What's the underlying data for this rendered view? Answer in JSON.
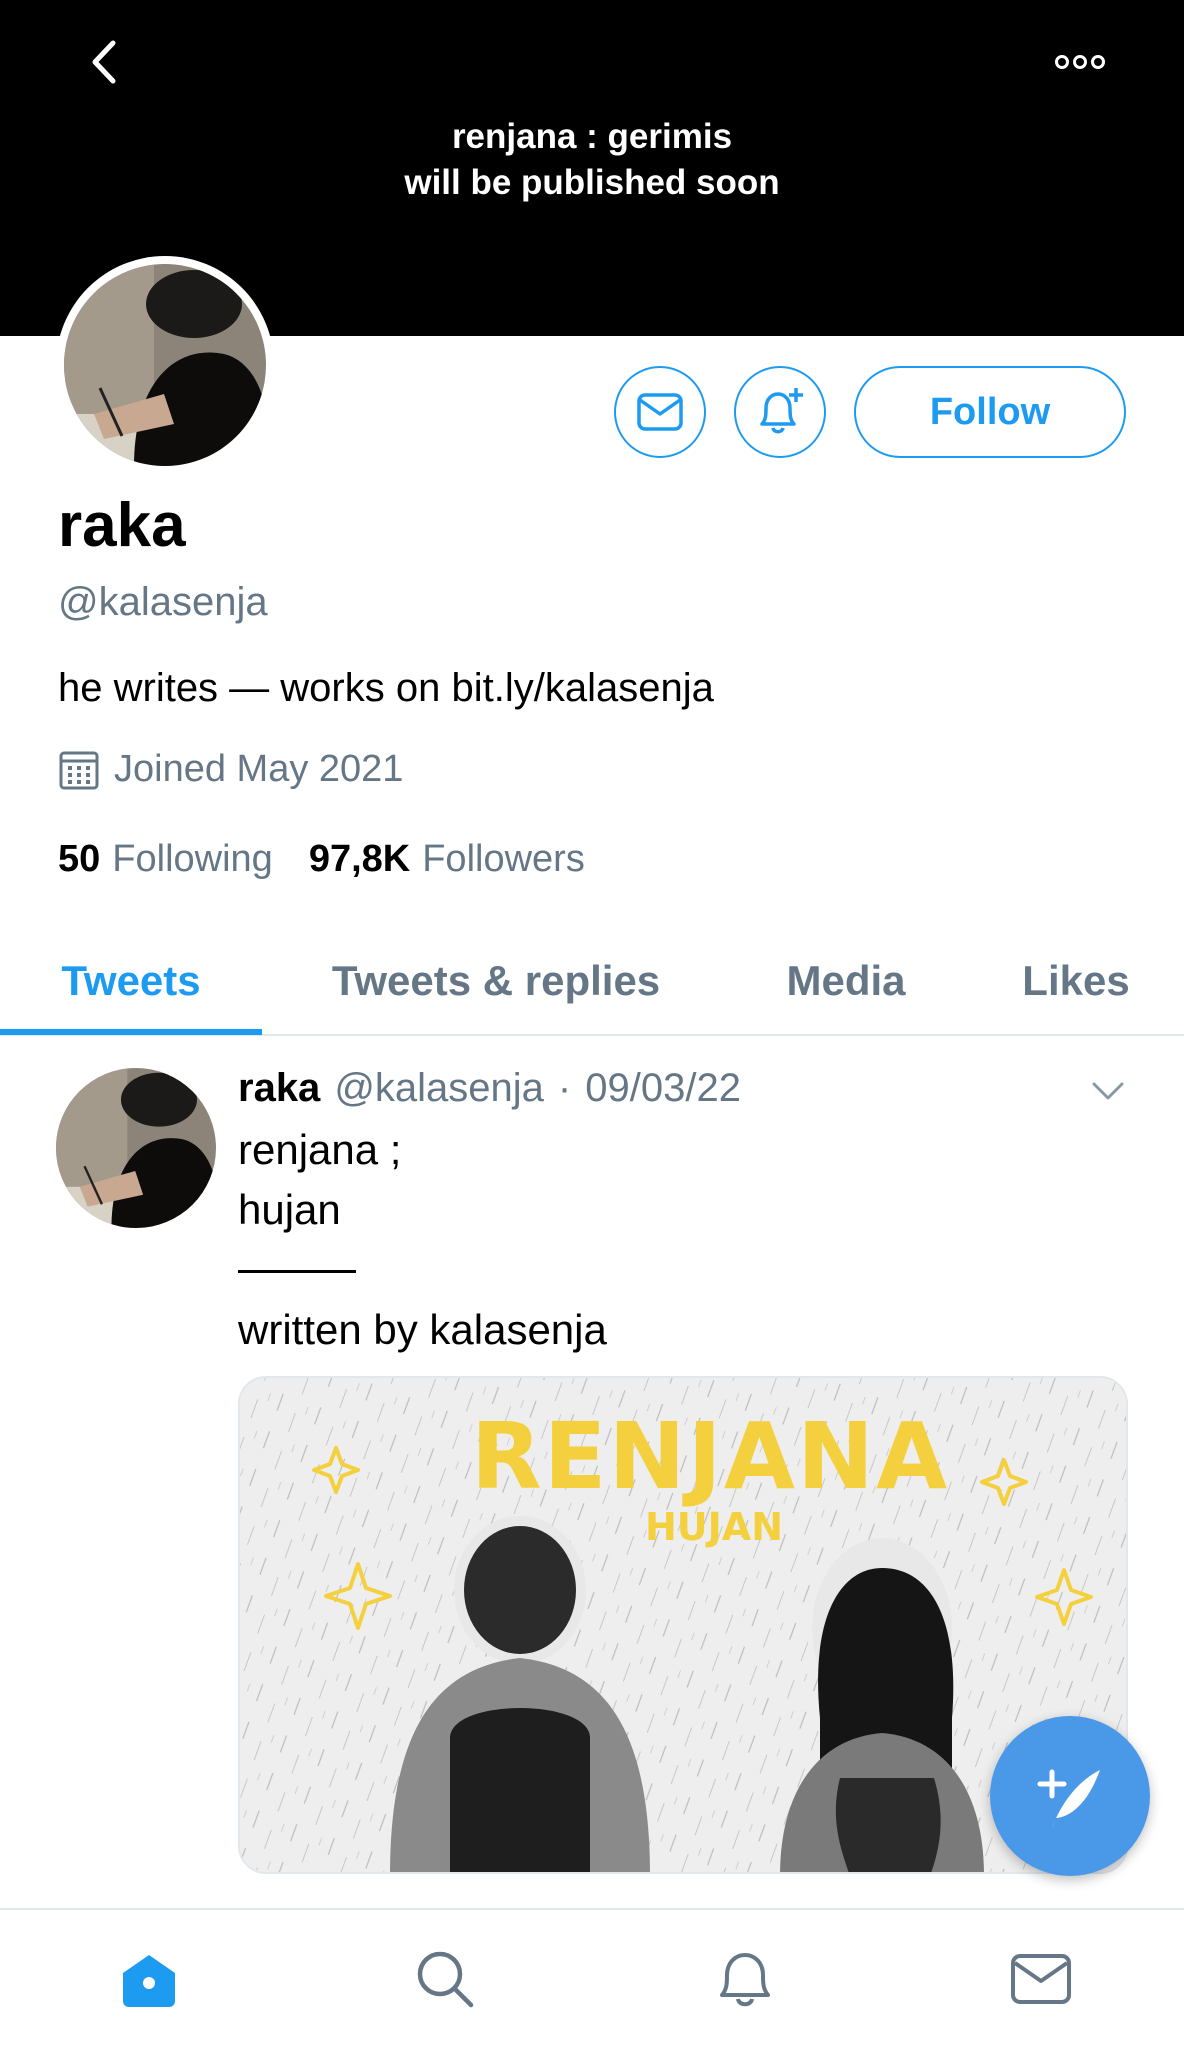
{
  "banner": {
    "line1": "renjana : gerimis",
    "line2": "will be published soon",
    "back_icon": "chevron-left-icon",
    "more_icon": "more-dots-icon"
  },
  "profile": {
    "display_name": "raka",
    "handle": "@kalasenja",
    "bio": "he writes — works on bit.ly/kalasenja",
    "joined": "Joined May 2021",
    "following_count": "50",
    "following_label": "Following",
    "followers_count": "97,8K",
    "followers_label": "Followers",
    "follow_label": "Follow"
  },
  "tabs": [
    {
      "label": "Tweets",
      "active": true
    },
    {
      "label": "Tweets & replies",
      "active": false
    },
    {
      "label": "Media",
      "active": false
    },
    {
      "label": "Likes",
      "active": false
    }
  ],
  "tweet": {
    "name": "raka",
    "handle": "@kalasenja",
    "separator": "·",
    "date": "09/03/22",
    "lines": [
      "renjana ;",
      "hujan",
      "written by kalasenja"
    ],
    "media": {
      "title": "RENJANA",
      "subtitle": "HUJAN"
    }
  },
  "colors": {
    "accent": "#1d9bf0",
    "fab": "#4a99e9",
    "secondary_text": "#657786",
    "media_title": "#f4d03f"
  },
  "nav": [
    "home-icon",
    "search-icon",
    "bell-icon",
    "mail-icon"
  ]
}
